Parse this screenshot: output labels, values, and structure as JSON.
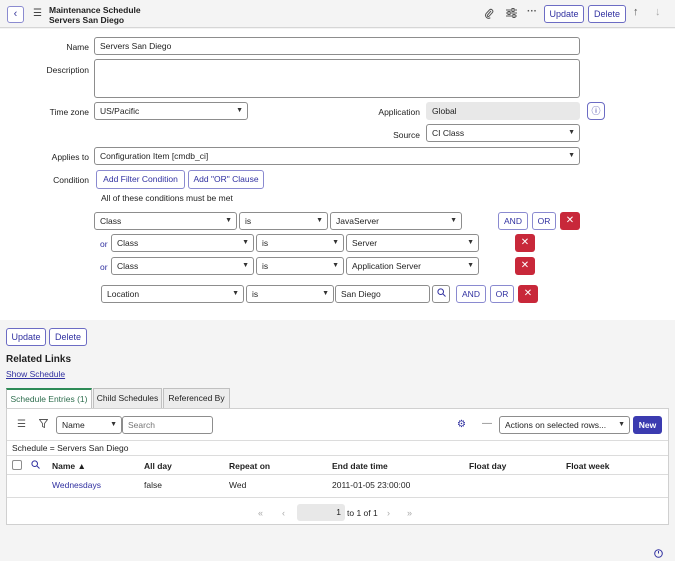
{
  "header": {
    "title_line1": "Maintenance Schedule",
    "title_line2": "Servers San Diego",
    "update_label": "Update",
    "delete_label": "Delete"
  },
  "form": {
    "name_label": "Name",
    "name_value": "Servers San Diego",
    "description_label": "Description",
    "description_value": "",
    "timezone_label": "Time zone",
    "timezone_value": "US/Pacific",
    "application_label": "Application",
    "application_value": "Global",
    "source_label": "Source",
    "source_value": "CI Class",
    "applies_to_label": "Applies to",
    "applies_to_value": "Configuration Item [cmdb_ci]",
    "condition_label": "Condition",
    "add_filter_label": "Add Filter Condition",
    "add_or_label": "Add \"OR\" Clause",
    "all_conditions_text": "All of these conditions must be met"
  },
  "conditions": [
    {
      "prefix": "",
      "field": "Class",
      "op": "is",
      "value": "JavaServer"
    },
    {
      "prefix": "or",
      "field": "Class",
      "op": "is",
      "value": "Server"
    },
    {
      "prefix": "or",
      "field": "Class",
      "op": "is",
      "value": "Application Server"
    },
    {
      "prefix": "",
      "field": "Location",
      "op": "is",
      "value": "San Diego"
    }
  ],
  "condition_buttons": {
    "and": "AND",
    "or": "OR",
    "delete": "✕"
  },
  "bottom_actions": {
    "update_label": "Update",
    "delete_label": "Delete"
  },
  "related_links": {
    "title": "Related Links",
    "show_schedule": "Show Schedule"
  },
  "tabs": [
    "Schedule Entries (1)",
    "Child Schedules",
    "Referenced By"
  ],
  "list": {
    "search_field": "Name",
    "search_placeholder": "Search",
    "actions_label": "Actions on selected rows...",
    "new_label": "New",
    "breadcrumb": "Schedule = Servers San Diego",
    "columns": [
      "Name ▲",
      "All day",
      "Repeat on",
      "End date time",
      "Float day",
      "Float week"
    ],
    "rows": [
      [
        "Wednesdays",
        "false",
        "Wed",
        "2011-01-05 23:00:00",
        "",
        ""
      ]
    ],
    "pagination": {
      "page": "1",
      "range_text": "to 1 of 1"
    }
  },
  "colors": {
    "accent": "#3030a0",
    "delete": "#c8283a",
    "active_tab": "#2e8b57"
  }
}
